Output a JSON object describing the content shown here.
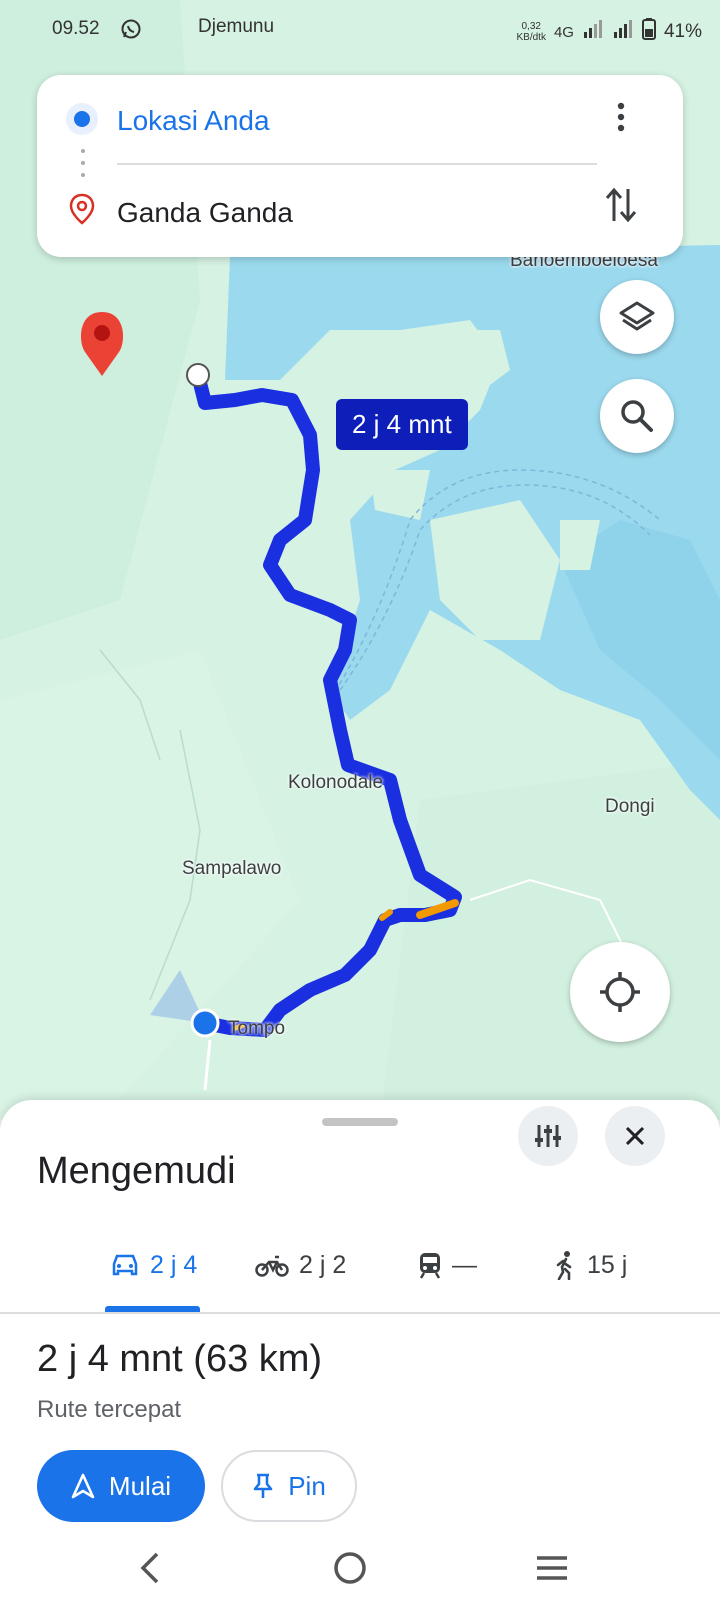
{
  "status_bar": {
    "time": "09.52",
    "carrier": "Djemunu",
    "speed_value": "0,32",
    "speed_unit": "KB/dtk",
    "network": "4G",
    "battery": "41%"
  },
  "search": {
    "origin": "Lokasi Anda",
    "destination": "Ganda Ganda"
  },
  "map": {
    "labels": {
      "bahoemboeloesa": "Bahoemboeloesa",
      "kolonodale": "Kolonodale",
      "dongi": "Dongi",
      "sampalawo": "Sampalawo",
      "tompo": "Tompo"
    },
    "route_duration": "2 j 4 mnt",
    "colors": {
      "route": "#1a2fe0",
      "traffic": "#f29900",
      "water": "#9bd9ee",
      "land": "#cdeedd"
    }
  },
  "sheet": {
    "title": "Mengemudi",
    "modes": [
      {
        "icon": "car-icon",
        "label": "2 j 4"
      },
      {
        "icon": "motorcycle-icon",
        "label": "2 j 2"
      },
      {
        "icon": "train-icon",
        "label": "—"
      },
      {
        "icon": "walk-icon",
        "label": "15 j"
      }
    ],
    "summary_time": "2 j 4 mnt",
    "summary_distance": "(63 km)",
    "route_type": "Rute tercepat",
    "start_label": "Mulai",
    "pin_label": "Pin"
  },
  "accent_color": "#1a73e8"
}
